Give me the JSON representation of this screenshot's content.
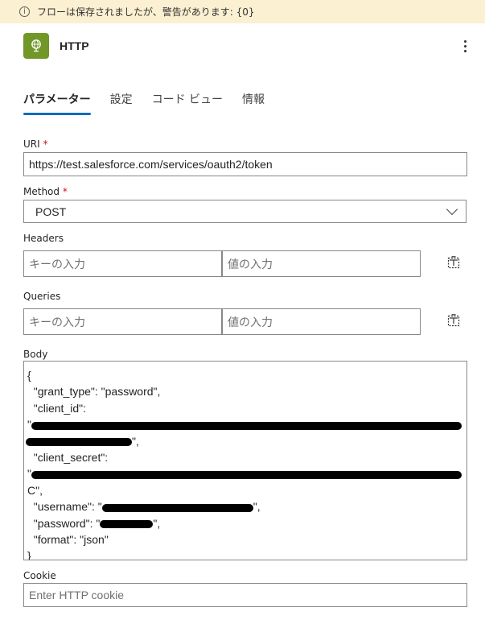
{
  "banner": {
    "icon": "info-icon",
    "text": "フローは保存されましたが、警告があります: {0}",
    "color": "#fcf0d2"
  },
  "action": {
    "icon": "globe-icon",
    "icon_color": "#709727",
    "title": "HTTP"
  },
  "tabs": [
    {
      "label": "パラメーター",
      "active": true
    },
    {
      "label": "設定",
      "active": false
    },
    {
      "label": "コード ビュー",
      "active": false
    },
    {
      "label": "情報",
      "active": false
    }
  ],
  "fields": {
    "uri": {
      "label": "URI",
      "required_mark": "*",
      "value": "https://test.salesforce.com/services/oauth2/token"
    },
    "method": {
      "label": "Method",
      "required_mark": "*",
      "value": "POST"
    },
    "headers": {
      "label": "Headers",
      "key_placeholder": "キーの入力",
      "value_placeholder": "値の入力"
    },
    "queries": {
      "label": "Queries",
      "key_placeholder": "キーの入力",
      "value_placeholder": "値の入力"
    },
    "body": {
      "label": "Body",
      "lines": [
        "{",
        "  \"grant_type\": \"password\",",
        "  \"client_id\":",
        "\"",
        "",
        "  \"client_secret\":",
        "\"",
        "C\",",
        "  \"username\": \"",
        "  \"password\": \"",
        "  \"format\": \"json\"",
        "}"
      ],
      "tails": {
        "client_id_end": "\",",
        "username_end": "\",",
        "password_end": "\","
      }
    },
    "cookie": {
      "label": "Cookie",
      "placeholder": "Enter HTTP cookie"
    }
  }
}
